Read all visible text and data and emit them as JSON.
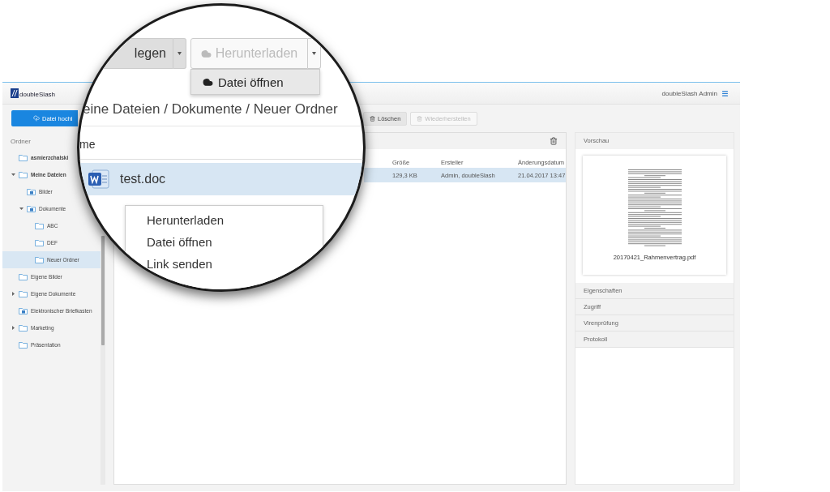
{
  "header": {
    "logo": "doubleSlash",
    "user": "doubleSlash Admin"
  },
  "toolbar": {
    "upload": "Datei hochl",
    "buttons": [
      {
        "label": "Löschen",
        "disabled": false
      },
      {
        "label": "Wiederherstellen",
        "disabled": true
      }
    ]
  },
  "sidebar": {
    "title": "Ordner",
    "items": [
      {
        "label": "asmierzchalski",
        "kind": "folder",
        "bold": true,
        "selected": false
      },
      {
        "label": "Meine Dateien",
        "kind": "folder",
        "bold": true,
        "expanded": true,
        "selected": false,
        "children": [
          {
            "label": "Bilder",
            "kind": "shared",
            "selected": false
          },
          {
            "label": "Dokumente",
            "kind": "shared",
            "expanded": true,
            "selected": false,
            "children": [
              {
                "label": "ABC",
                "kind": "folder",
                "selected": false
              },
              {
                "label": "DEF",
                "kind": "folder",
                "selected": false
              },
              {
                "label": "Neuer Ordner",
                "kind": "folder",
                "selected": true
              }
            ]
          }
        ]
      },
      {
        "label": "Eigene Bilder",
        "kind": "folder",
        "selected": false
      },
      {
        "label": "Eigene Dokumente",
        "kind": "folder",
        "expanded": false,
        "selected": false
      },
      {
        "label": "Elektronischer Briefkasten",
        "kind": "shared",
        "selected": false
      },
      {
        "label": "Marketing",
        "kind": "folder",
        "expanded": false,
        "selected": false
      },
      {
        "label": "Präsentation",
        "kind": "folder",
        "selected": false
      }
    ]
  },
  "table": {
    "columns": [
      "Größe",
      "Ersteller",
      "Änderungsdatum"
    ],
    "rows": [
      {
        "cells": [
          "129,3 KB",
          "Admin, doubleSlash",
          "21.04.2017 13:47"
        ],
        "selected": true
      }
    ]
  },
  "details": {
    "sections": [
      {
        "title": "Vorschau",
        "expanded": true,
        "file": "20170421_Rahmenvertrag.pdf"
      },
      {
        "title": "Eigenschaften",
        "expanded": false
      },
      {
        "title": "Zugriff",
        "expanded": false
      },
      {
        "title": "Virenprüfung",
        "expanded": false
      },
      {
        "title": "Protokoll",
        "expanded": false
      }
    ]
  },
  "magnifier": {
    "toolbar": [
      {
        "label": "legen",
        "disabled": false
      },
      {
        "label": "Herunterladen",
        "disabled": true
      }
    ],
    "dropdown_items": [
      "Datei öffnen"
    ],
    "breadcrumb": "eine Dateien / Dokumente / Neuer Ordner",
    "column": "me",
    "row": {
      "name": "test.doc",
      "selected": true
    },
    "context_menu": [
      "Herunterladen",
      "Datei öffnen",
      "Link senden"
    ]
  }
}
